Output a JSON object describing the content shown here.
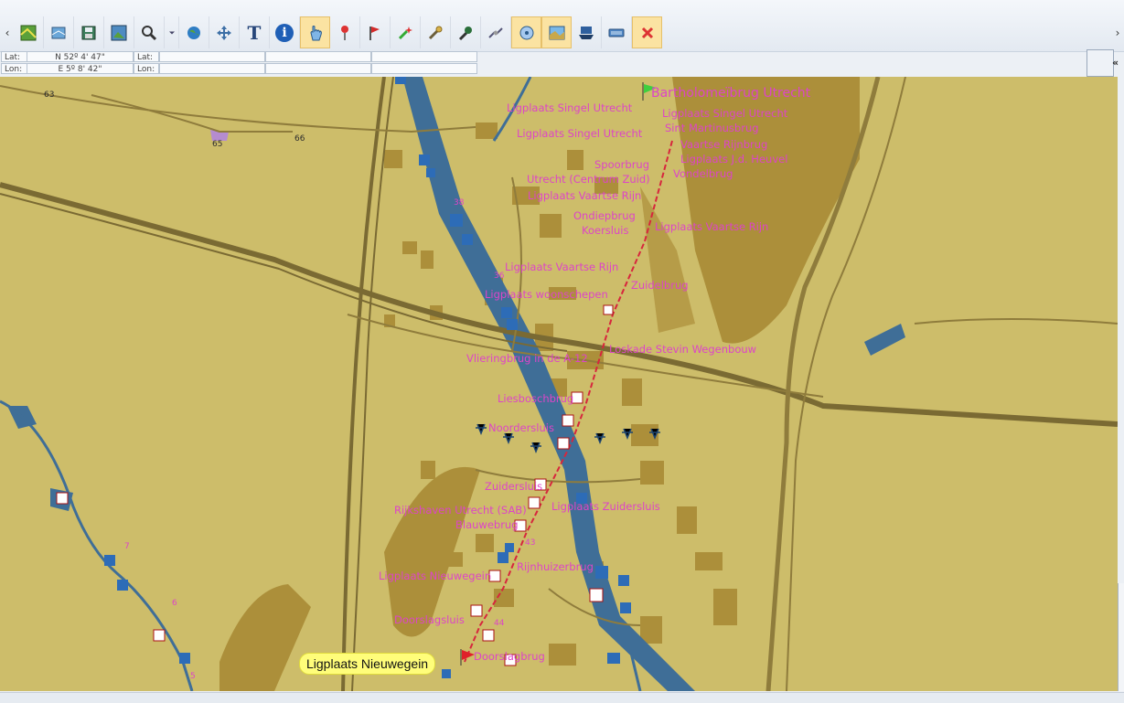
{
  "toolbar": {
    "scroll_left": "‹",
    "scroll_right": "›",
    "tools": [
      {
        "icon": "chart-open-icon"
      },
      {
        "icon": "chart-layers-icon"
      },
      {
        "icon": "save-icon"
      },
      {
        "icon": "chart-export-icon"
      },
      {
        "icon": "zoom-icon"
      },
      {
        "icon": "zoom-dropdown-icon"
      },
      {
        "icon": "globe-icon"
      },
      {
        "icon": "pan-arrows-icon"
      },
      {
        "icon": "text-tool-icon"
      },
      {
        "icon": "info-icon"
      },
      {
        "icon": "hand-select-icon",
        "active": true
      },
      {
        "icon": "pushpin-icon"
      },
      {
        "icon": "flag-icon"
      },
      {
        "icon": "sparkle-tool-icon"
      },
      {
        "icon": "wrench-icon"
      },
      {
        "icon": "microphone-icon"
      },
      {
        "icon": "satellite-icon"
      },
      {
        "icon": "gps-target-icon",
        "active": true
      },
      {
        "icon": "map-layer-icon",
        "active": true
      },
      {
        "icon": "ship-icon"
      },
      {
        "icon": "keyboard-icon"
      },
      {
        "icon": "close-x-icon",
        "active": true
      }
    ],
    "text_tool_glyph": "T",
    "info_glyph": "i"
  },
  "coords": {
    "lat_label": "Lat:",
    "lat_value": "N 52º 4' 47\"",
    "lat2_label": "Lat:",
    "lon_label": "Lon:",
    "lon_value": "E 5º 8' 42\"",
    "lon2_label": "Lon:"
  },
  "right_panel": {
    "collapse_glyph": "«"
  },
  "map": {
    "route_tooltip": "Ligplaats Nieuwegein",
    "route_numbers": [
      "63",
      "65",
      "66",
      "38",
      "36",
      "6",
      "5",
      "7",
      "44",
      "43"
    ],
    "labels": [
      "Bartholomeïbrug Utrecht",
      "Ligplaats Singel Utrecht",
      "Ligplaats Singel Utrecht",
      "Ligplaats Singel Utrecht",
      "Sint Martinusbrug",
      "Vaartse Rijnbrug",
      "Ligplaats J.d. Heuvel",
      "Spoorbrug",
      "Vondelbrug",
      "Utrecht (Centrum Zuid)",
      "Ligplaats Vaartse Rijn",
      "Ondiepbrug",
      "Ligplaats Vaartse Rijn",
      "Koersluis",
      "Ligplaats Vaartse Rijn",
      "Zuidelbrug",
      "Ligplaats woonschepen",
      "Loskade Stevin Wegenbouw",
      "Vlieringbrug in de A-12",
      "Liesboschbrug",
      "Noordersluis",
      "Zuidersluis",
      "Ligplaats Zuidersluis",
      "Rijkshaven Utrecht (SAB)",
      "Blauwebrug",
      "Rijnhuizerbrug",
      "Ligplaats Nieuwegein",
      "Doorslagsluis",
      "Doorslagbrug"
    ]
  },
  "colors": {
    "land": "#cdbd6a",
    "built": "#ac8f3a",
    "water": "#3f6e97",
    "label": "#dd45c7",
    "route": "#d7263d"
  }
}
